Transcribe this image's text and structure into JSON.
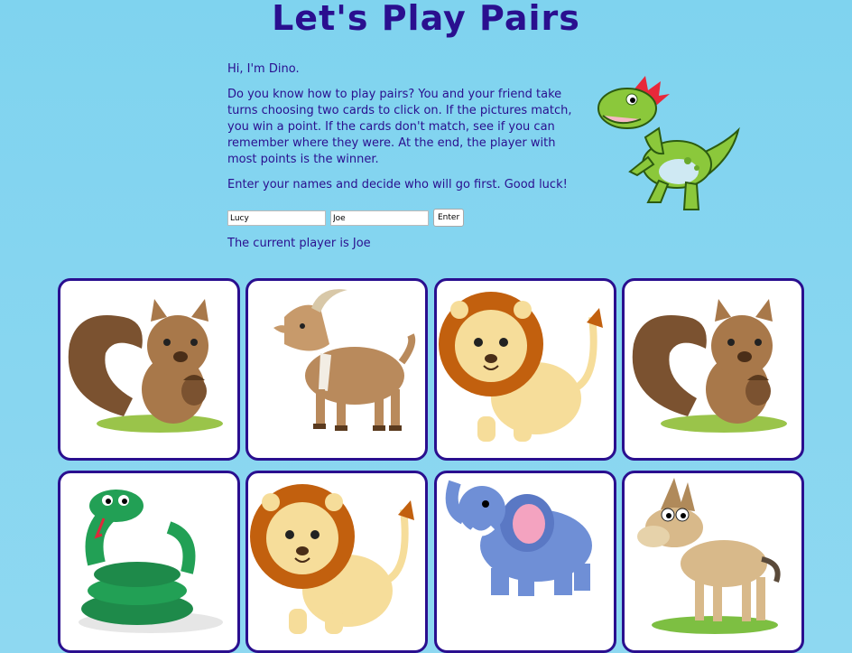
{
  "title": "Let's Play Pairs",
  "intro": {
    "greeting": "Hi, I'm Dino.",
    "rules": "Do you know how to play pairs? You and your friend take turns choosing two cards to click on. If the pictures match, you win a point. If the cards don't match, see if you can remember where they were. At the end, the player with most points is the winner.",
    "instruction": "Enter your names and decide who will go first. Good luck!"
  },
  "players": {
    "player1_value": "Lucy",
    "player2_value": "Joe",
    "enter_label": "Enter"
  },
  "status": {
    "current_player_text": "The current player is Joe"
  },
  "cards": [
    {
      "animal": "squirrel"
    },
    {
      "animal": "goat"
    },
    {
      "animal": "lion"
    },
    {
      "animal": "squirrel"
    },
    {
      "animal": "snake"
    },
    {
      "animal": "lion"
    },
    {
      "animal": "elephant"
    },
    {
      "animal": "donkey"
    }
  ],
  "colors": {
    "background": "#7fd3ef",
    "accent": "#2a0f8f",
    "card_border": "#2a0f8f"
  }
}
